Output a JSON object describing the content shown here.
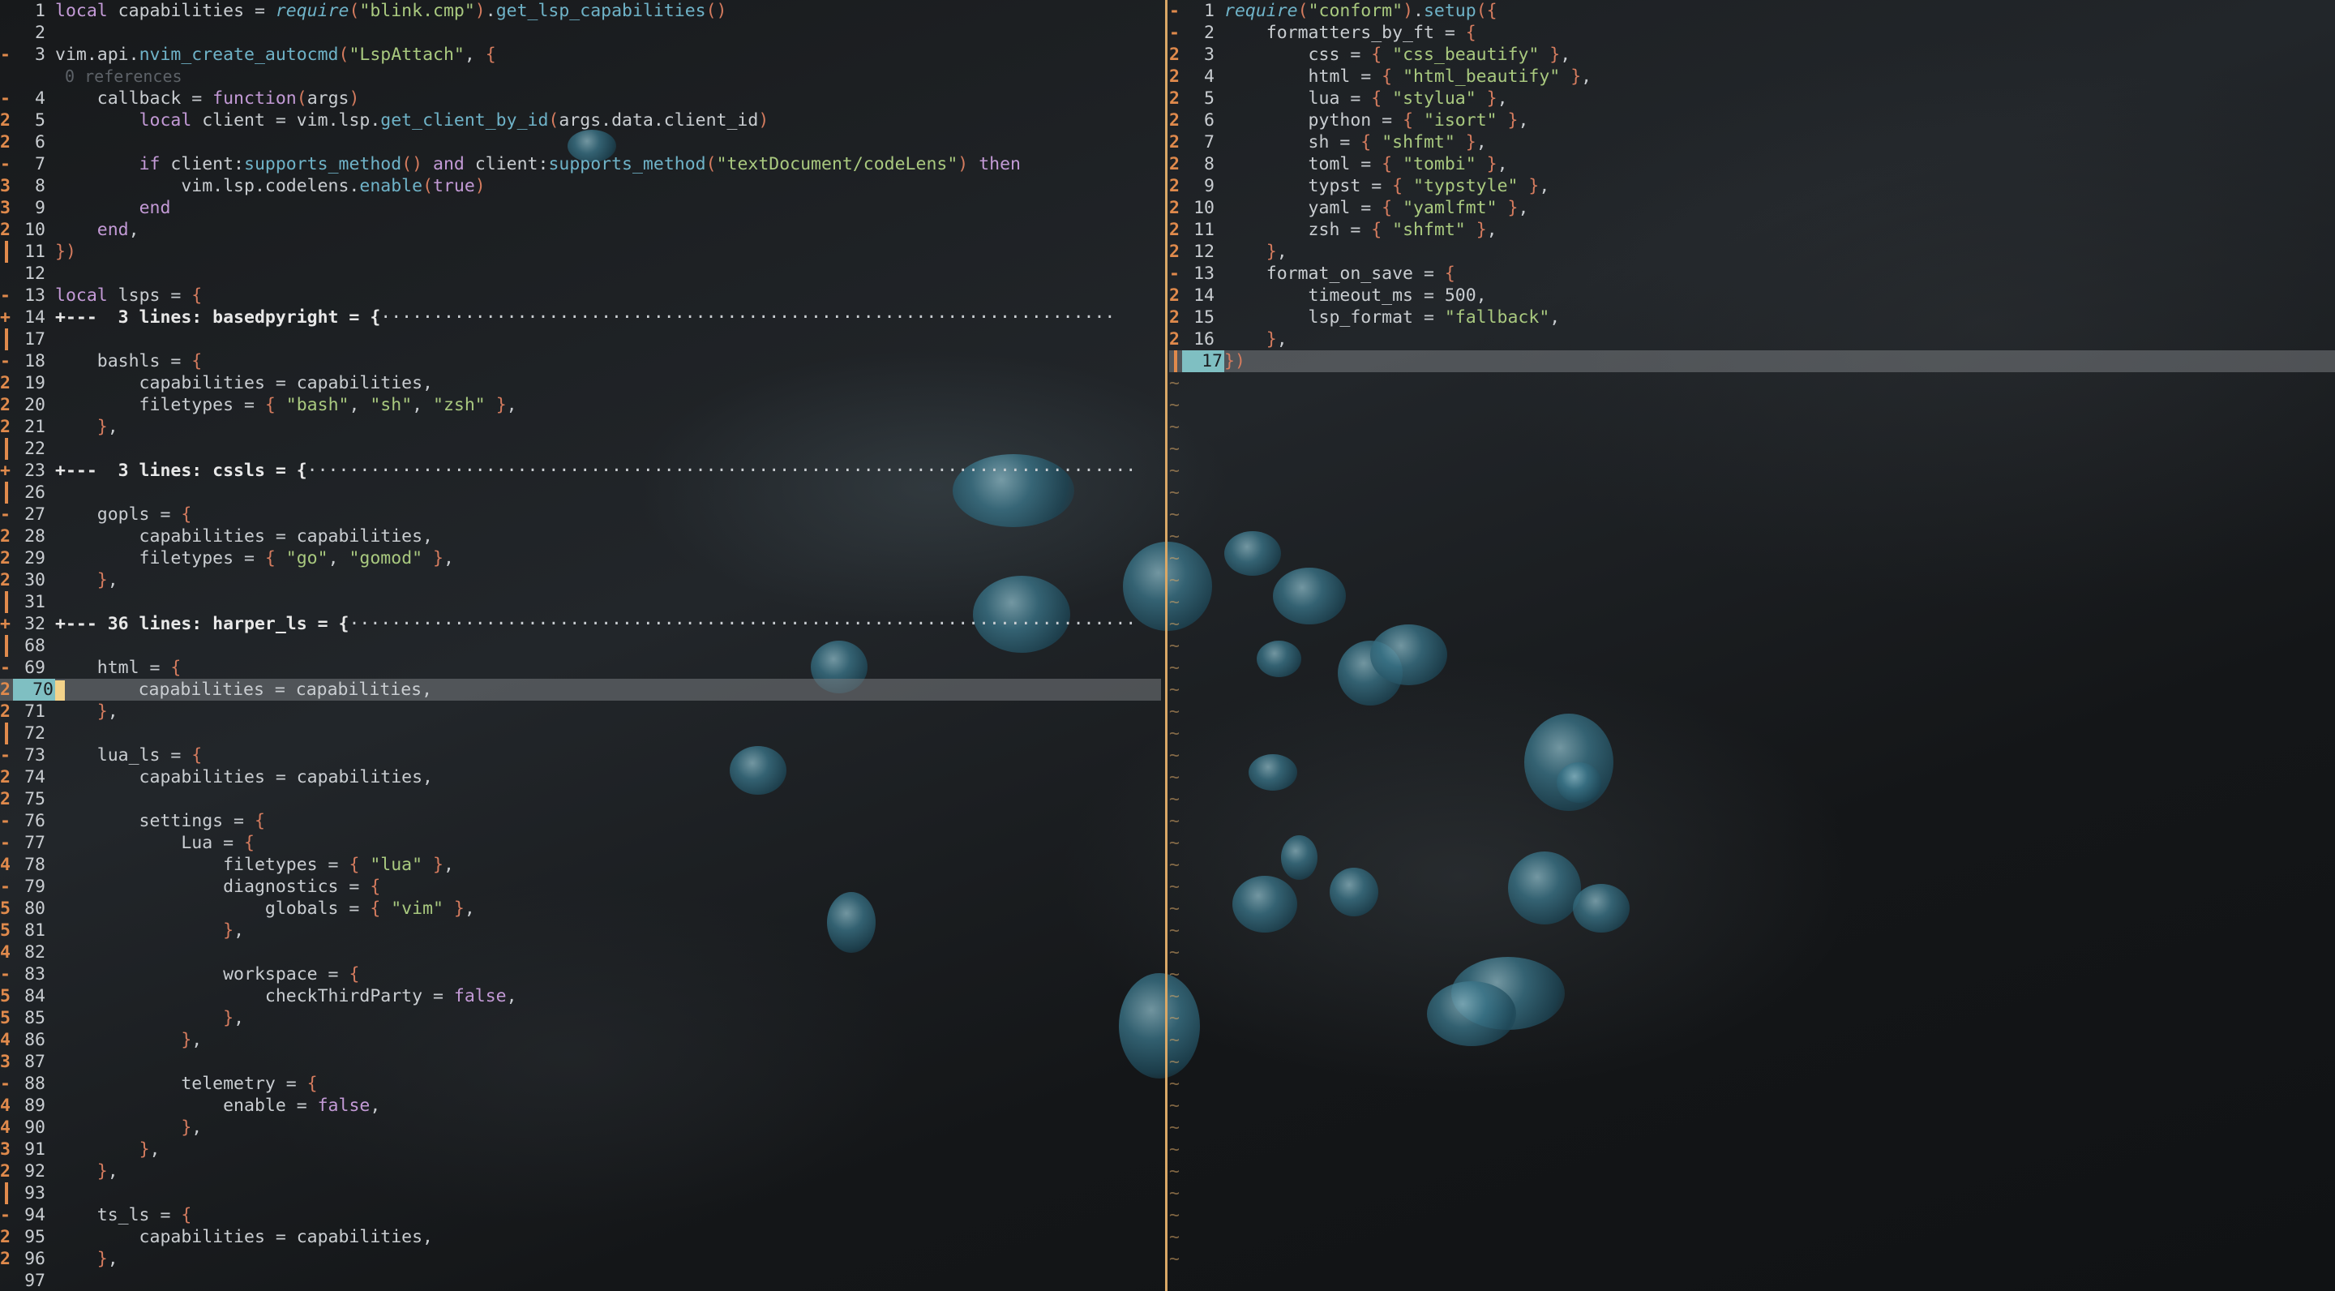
{
  "colors": {
    "accent": "#d9a766",
    "git_sign": "#e08a4c",
    "cursor_line_number": "#7fbfc2"
  },
  "left": {
    "lines": [
      {
        "sign": "",
        "num": "1",
        "html": "<span class='k'>local</span> capabilities = <span class='it'>require</span><span class='p'>(</span><span class='s'>\"blink.cmp\"</span><span class='p'>)</span>.<span class='f'>get_lsp_capabilities</span><span class='p'>()</span>"
      },
      {
        "sign": "",
        "num": "2",
        "html": ""
      },
      {
        "sign": "-",
        "num": "3",
        "html": "vim.api.<span class='f'>nvim_create_autocmd</span><span class='p'>(</span><span class='s'>\"LspAttach\"</span>, <span class='p'>{</span>"
      },
      {
        "sign": "",
        "num": "",
        "html": "<span class='vref'> 0 references</span>"
      },
      {
        "sign": "-",
        "num": "4",
        "html": "    callback = <span class='k'>function</span><span class='p'>(</span>args<span class='p'>)</span>"
      },
      {
        "sign": "2",
        "num": "5",
        "html": "        <span class='k'>local</span> client = vim.lsp.<span class='f'>get_client_by_id</span><span class='p'>(</span>args.data.client_id<span class='p'>)</span>"
      },
      {
        "sign": "2",
        "num": "6",
        "html": ""
      },
      {
        "sign": "-",
        "num": "7",
        "html": "        <span class='k'>if</span> client:<span class='f'>supports_method</span><span class='p'>()</span> <span class='k'>and</span> client:<span class='f'>supports_method</span><span class='p'>(</span><span class='s'>\"textDocument/codeLens\"</span><span class='p'>)</span> <span class='k'>then</span>"
      },
      {
        "sign": "3",
        "num": "8",
        "html": "            vim.lsp.codelens.<span class='f'>enable</span><span class='p'>(</span><span class='k'>true</span><span class='p'>)</span>"
      },
      {
        "sign": "3",
        "num": "9",
        "html": "        <span class='k'>end</span>"
      },
      {
        "sign": "2",
        "num": "10",
        "html": "    <span class='k'>end</span>,"
      },
      {
        "sign": "bar",
        "num": "11",
        "html": "<span class='p'>})</span>"
      },
      {
        "sign": "",
        "num": "12",
        "html": ""
      },
      {
        "sign": "-",
        "num": "13",
        "html": "<span class='k'>local</span> lsps = <span class='p'>{</span>"
      },
      {
        "sign": "+",
        "num": "14",
        "html": "<span class='fold'>+---  3 lines: basedpyright = {</span><span class='dots'>······································································</span>"
      },
      {
        "sign": "bar",
        "num": "17",
        "html": ""
      },
      {
        "sign": "-",
        "num": "18",
        "html": "    bashls = <span class='p'>{</span>"
      },
      {
        "sign": "2",
        "num": "19",
        "html": "        capabilities = capabilities,"
      },
      {
        "sign": "2",
        "num": "20",
        "html": "        filetypes = <span class='p'>{</span> <span class='s'>\"bash\"</span>, <span class='s'>\"sh\"</span>, <span class='s'>\"zsh\"</span> <span class='p'>}</span>,"
      },
      {
        "sign": "2",
        "num": "21",
        "html": "    <span class='p'>}</span>,"
      },
      {
        "sign": "bar",
        "num": "22",
        "html": ""
      },
      {
        "sign": "+",
        "num": "23",
        "html": "<span class='fold'>+---  3 lines: cssls = {</span><span class='dots'>···············································································</span>"
      },
      {
        "sign": "bar",
        "num": "26",
        "html": ""
      },
      {
        "sign": "-",
        "num": "27",
        "html": "    gopls = <span class='p'>{</span>"
      },
      {
        "sign": "2",
        "num": "28",
        "html": "        capabilities = capabilities,"
      },
      {
        "sign": "2",
        "num": "29",
        "html": "        filetypes = <span class='p'>{</span> <span class='s'>\"go\"</span>, <span class='s'>\"gomod\"</span> <span class='p'>}</span>,"
      },
      {
        "sign": "2",
        "num": "30",
        "html": "    <span class='p'>}</span>,"
      },
      {
        "sign": "bar",
        "num": "31",
        "html": ""
      },
      {
        "sign": "+",
        "num": "32",
        "html": "<span class='fold'>+--- 36 lines: harper_ls = {</span><span class='dots'>···········································································</span>"
      },
      {
        "sign": "bar",
        "num": "68",
        "html": ""
      },
      {
        "sign": "-",
        "num": "69",
        "html": "    html = <span class='p'>{</span>"
      },
      {
        "sign": "2",
        "num": "70",
        "cur": true,
        "html": "<span class='cursor'></span>       capabilities = capabilities,"
      },
      {
        "sign": "2",
        "num": "71",
        "html": "    <span class='p'>}</span>,"
      },
      {
        "sign": "bar",
        "num": "72",
        "html": ""
      },
      {
        "sign": "-",
        "num": "73",
        "html": "    lua_ls = <span class='p'>{</span>"
      },
      {
        "sign": "2",
        "num": "74",
        "html": "        capabilities = capabilities,"
      },
      {
        "sign": "2",
        "num": "75",
        "html": ""
      },
      {
        "sign": "-",
        "num": "76",
        "html": "        settings = <span class='p'>{</span>"
      },
      {
        "sign": "-",
        "num": "77",
        "html": "            Lua = <span class='p'>{</span>"
      },
      {
        "sign": "4",
        "num": "78",
        "html": "                filetypes = <span class='p'>{</span> <span class='s'>\"lua\"</span> <span class='p'>}</span>,"
      },
      {
        "sign": "-",
        "num": "79",
        "html": "                diagnostics = <span class='p'>{</span>"
      },
      {
        "sign": "5",
        "num": "80",
        "html": "                    globals = <span class='p'>{</span> <span class='s'>\"vim\"</span> <span class='p'>}</span>,"
      },
      {
        "sign": "5",
        "num": "81",
        "html": "                <span class='p'>}</span>,"
      },
      {
        "sign": "4",
        "num": "82",
        "html": ""
      },
      {
        "sign": "-",
        "num": "83",
        "html": "                workspace = <span class='p'>{</span>"
      },
      {
        "sign": "5",
        "num": "84",
        "html": "                    checkThirdParty = <span class='k'>false</span>,"
      },
      {
        "sign": "5",
        "num": "85",
        "html": "                <span class='p'>}</span>,"
      },
      {
        "sign": "4",
        "num": "86",
        "html": "            <span class='p'>}</span>,"
      },
      {
        "sign": "3",
        "num": "87",
        "html": ""
      },
      {
        "sign": "-",
        "num": "88",
        "html": "            telemetry = <span class='p'>{</span>"
      },
      {
        "sign": "4",
        "num": "89",
        "html": "                enable = <span class='k'>false</span>,"
      },
      {
        "sign": "4",
        "num": "90",
        "html": "            <span class='p'>}</span>,"
      },
      {
        "sign": "3",
        "num": "91",
        "html": "        <span class='p'>}</span>,"
      },
      {
        "sign": "2",
        "num": "92",
        "html": "    <span class='p'>}</span>,"
      },
      {
        "sign": "bar",
        "num": "93",
        "html": ""
      },
      {
        "sign": "-",
        "num": "94",
        "html": "    ts_ls = <span class='p'>{</span>"
      },
      {
        "sign": "2",
        "num": "95",
        "html": "        capabilities = capabilities,"
      },
      {
        "sign": "2",
        "num": "96",
        "html": "    <span class='p'>}</span>,"
      },
      {
        "sign": "",
        "num": "97",
        "html": ""
      }
    ]
  },
  "right": {
    "lines": [
      {
        "sign": "-",
        "num": "1",
        "html": "<span class='it'>require</span><span class='p'>(</span><span class='s'>\"conform\"</span><span class='p'>)</span>.<span class='f'>setup</span><span class='p'>({</span>"
      },
      {
        "sign": "-",
        "num": "2",
        "html": "    formatters_by_ft = <span class='p'>{</span>"
      },
      {
        "sign": "2",
        "num": "3",
        "html": "        css = <span class='p'>{</span> <span class='s'>\"css_beautify\"</span> <span class='p'>}</span>,"
      },
      {
        "sign": "2",
        "num": "4",
        "html": "        html = <span class='p'>{</span> <span class='s'>\"html_beautify\"</span> <span class='p'>}</span>,"
      },
      {
        "sign": "2",
        "num": "5",
        "html": "        lua = <span class='p'>{</span> <span class='s'>\"stylua\"</span> <span class='p'>}</span>,"
      },
      {
        "sign": "2",
        "num": "6",
        "html": "        python = <span class='p'>{</span> <span class='s'>\"isort\"</span> <span class='p'>}</span>,"
      },
      {
        "sign": "2",
        "num": "7",
        "html": "        sh = <span class='p'>{</span> <span class='s'>\"shfmt\"</span> <span class='p'>}</span>,"
      },
      {
        "sign": "2",
        "num": "8",
        "html": "        toml = <span class='p'>{</span> <span class='s'>\"tombi\"</span> <span class='p'>}</span>,"
      },
      {
        "sign": "2",
        "num": "9",
        "html": "        typst = <span class='p'>{</span> <span class='s'>\"typstyle\"</span> <span class='p'>}</span>,"
      },
      {
        "sign": "2",
        "num": "10",
        "html": "        yaml = <span class='p'>{</span> <span class='s'>\"yamlfmt\"</span> <span class='p'>}</span>,"
      },
      {
        "sign": "2",
        "num": "11",
        "html": "        zsh = <span class='p'>{</span> <span class='s'>\"shfmt\"</span> <span class='p'>}</span>,"
      },
      {
        "sign": "2",
        "num": "12",
        "html": "    <span class='p'>}</span>,"
      },
      {
        "sign": "-",
        "num": "13",
        "html": "    format_on_save = <span class='p'>{</span>"
      },
      {
        "sign": "2",
        "num": "14",
        "html": "        timeout_ms = 500,"
      },
      {
        "sign": "2",
        "num": "15",
        "html": "        lsp_format = <span class='s'>\"fallback\"</span>,"
      },
      {
        "sign": "2",
        "num": "16",
        "html": "    <span class='p'>}</span>,"
      },
      {
        "sign": "bar",
        "num": "17",
        "cur": true,
        "html": "<span class='p'>})</span>"
      }
    ],
    "tilde_rows": 41
  }
}
